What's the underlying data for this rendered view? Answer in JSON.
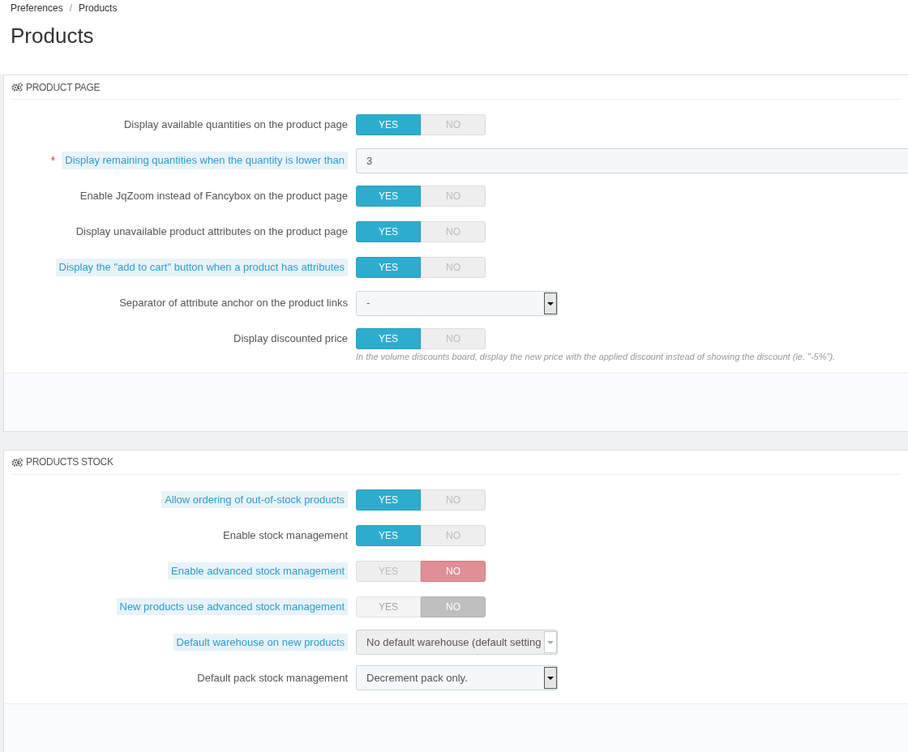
{
  "breadcrumb": [
    "Preferences",
    "Products"
  ],
  "breadcrumb_separator": "/",
  "title": "Products",
  "panels": [
    {
      "heading": "PRODUCT PAGE",
      "rows": [
        {
          "kind": "toggle",
          "label": "Display available quantities on the product page",
          "hint": false,
          "disabled": false,
          "options": [
            {
              "label": "YES",
              "selected": true
            },
            {
              "label": "NO",
              "selected": false
            }
          ]
        },
        {
          "kind": "text",
          "label": "Display remaining quantities when the quantity is lower than",
          "hint": true,
          "required_mark": "*",
          "value": "3"
        },
        {
          "kind": "toggle",
          "label": "Enable JqZoom instead of Fancybox on the product page",
          "hint": false,
          "disabled": false,
          "options": [
            {
              "label": "YES",
              "selected": true
            },
            {
              "label": "NO",
              "selected": false
            }
          ]
        },
        {
          "kind": "toggle",
          "label": "Display unavailable product attributes on the product page",
          "hint": false,
          "disabled": false,
          "options": [
            {
              "label": "YES",
              "selected": true
            },
            {
              "label": "NO",
              "selected": false
            }
          ]
        },
        {
          "kind": "toggle",
          "label": "Display the \"add to cart\" button when a product has attributes",
          "hint": true,
          "disabled": false,
          "options": [
            {
              "label": "YES",
              "selected": true
            },
            {
              "label": "NO",
              "selected": false
            }
          ]
        },
        {
          "kind": "select",
          "label": "Separator of attribute anchor on the product links",
          "hint": false,
          "disabled": false,
          "value": "-"
        },
        {
          "kind": "toggle",
          "label": "Display discounted price",
          "hint": false,
          "disabled": false,
          "options": [
            {
              "label": "YES",
              "selected": true
            },
            {
              "label": "NO",
              "selected": false
            }
          ],
          "help": "In the volume discounts board, display the new price with the applied discount instead of showing the discount (ie. \"-5%\")."
        }
      ]
    },
    {
      "heading": "PRODUCTS STOCK",
      "rows": [
        {
          "kind": "toggle",
          "label": "Allow ordering of out-of-stock products",
          "hint": true,
          "disabled": false,
          "options": [
            {
              "label": "YES",
              "selected": true
            },
            {
              "label": "NO",
              "selected": false
            }
          ]
        },
        {
          "kind": "toggle",
          "label": "Enable stock management",
          "hint": false,
          "disabled": false,
          "options": [
            {
              "label": "YES",
              "selected": true
            },
            {
              "label": "NO",
              "selected": false
            }
          ]
        },
        {
          "kind": "toggle",
          "label": "Enable advanced stock management",
          "hint": true,
          "disabled": false,
          "options": [
            {
              "label": "YES",
              "selected": false
            },
            {
              "label": "NO",
              "selected": true
            }
          ]
        },
        {
          "kind": "toggle",
          "label": "New products use advanced stock management",
          "hint": true,
          "disabled": true,
          "options": [
            {
              "label": "YES",
              "selected": false
            },
            {
              "label": "NO",
              "selected": true
            }
          ]
        },
        {
          "kind": "select",
          "label": "Default warehouse on new products",
          "hint": true,
          "disabled": true,
          "value": "No default warehouse (default setting"
        },
        {
          "kind": "select",
          "label": "Default pack stock management",
          "hint": false,
          "disabled": false,
          "value": "Decrement pack only."
        }
      ]
    }
  ]
}
